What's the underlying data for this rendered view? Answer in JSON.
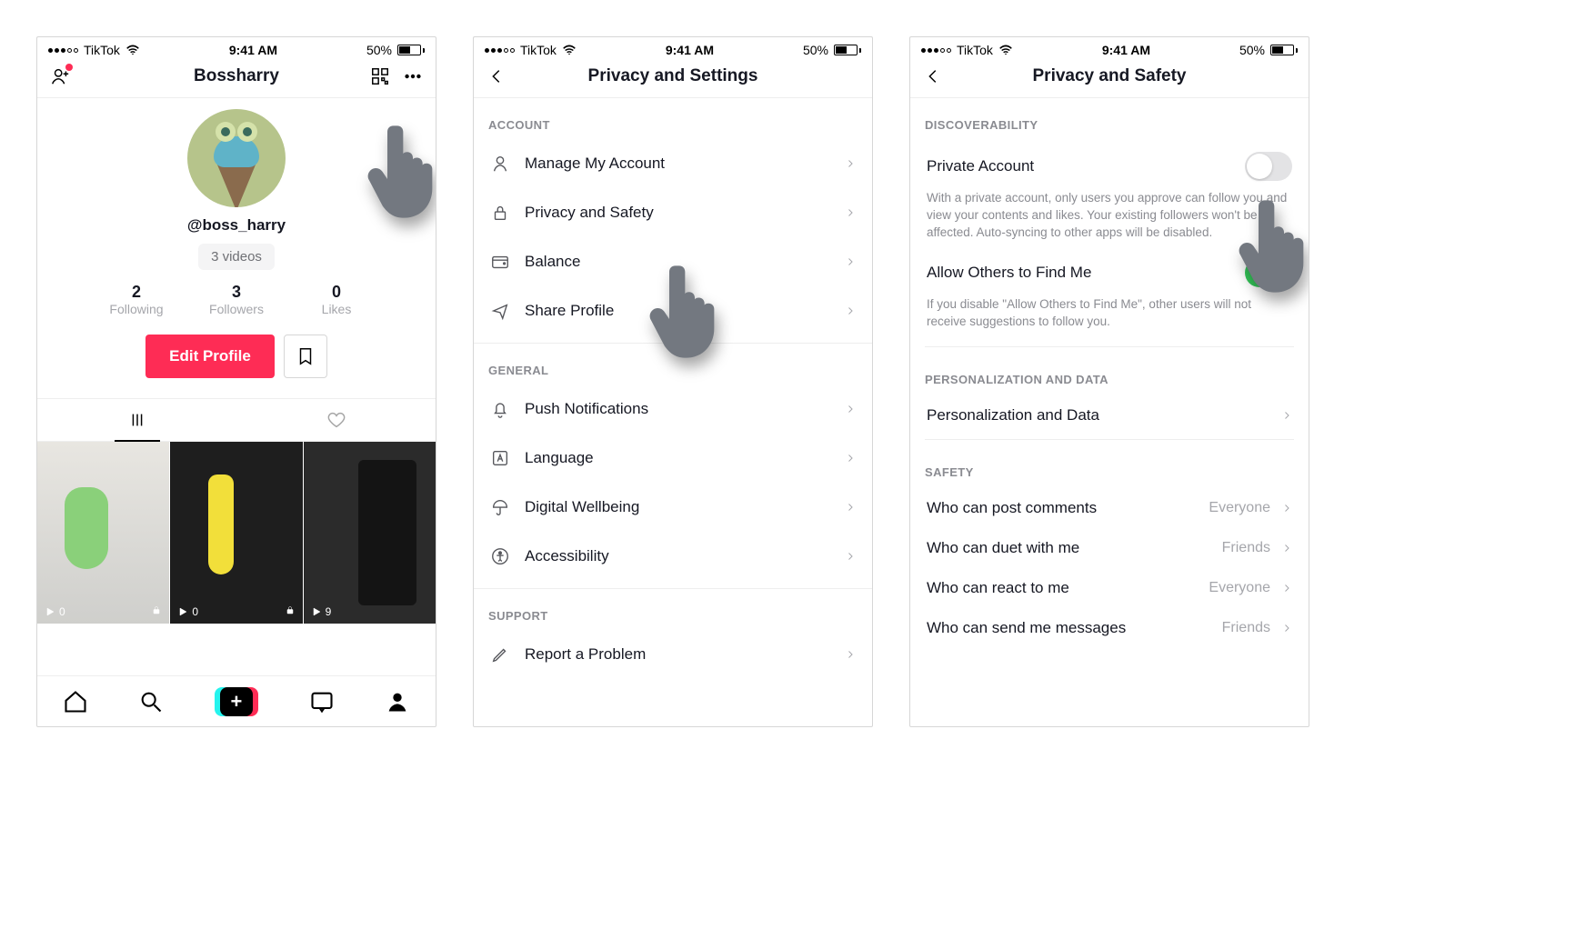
{
  "status": {
    "carrier": "TikTok",
    "time": "9:41 AM",
    "battery": "50%"
  },
  "screen1": {
    "title": "Bossharry",
    "username": "@boss_harry",
    "videos_chip": "3 videos",
    "stats": [
      {
        "num": "2",
        "label": "Following"
      },
      {
        "num": "3",
        "label": "Followers"
      },
      {
        "num": "0",
        "label": "Likes"
      }
    ],
    "edit_label": "Edit Profile",
    "thumbs": [
      {
        "plays": "0",
        "locked": true
      },
      {
        "plays": "0",
        "locked": true
      },
      {
        "plays": "9",
        "locked": false
      }
    ]
  },
  "screen2": {
    "title": "Privacy and Settings",
    "sections": {
      "account": {
        "header": "ACCOUNT",
        "items": [
          {
            "label": "Manage My Account"
          },
          {
            "label": "Privacy and Safety"
          },
          {
            "label": "Balance"
          },
          {
            "label": "Share Profile"
          }
        ]
      },
      "general": {
        "header": "GENERAL",
        "items": [
          {
            "label": "Push Notifications"
          },
          {
            "label": "Language"
          },
          {
            "label": "Digital Wellbeing"
          },
          {
            "label": "Accessibility"
          }
        ]
      },
      "support": {
        "header": "SUPPORT",
        "items": [
          {
            "label": "Report a Problem"
          }
        ]
      }
    }
  },
  "screen3": {
    "title": "Privacy and Safety",
    "discoverability_header": "DISCOVERABILITY",
    "private_account": {
      "label": "Private Account",
      "desc": "With a private account, only users you approve can follow you and view your contents and likes. Your existing followers won't be affected. Auto-syncing to other apps will be disabled.",
      "on": false
    },
    "allow_find": {
      "label": "Allow Others to Find Me",
      "desc": "If you disable \"Allow Others to Find Me\", other users will not receive suggestions to follow you.",
      "on": true
    },
    "personalization_header": "PERSONALIZATION AND DATA",
    "personalization_label": "Personalization and Data",
    "safety_header": "SAFETY",
    "safety_rows": [
      {
        "label": "Who can post comments",
        "value": "Everyone"
      },
      {
        "label": "Who can duet with me",
        "value": "Friends"
      },
      {
        "label": "Who can react to me",
        "value": "Everyone"
      },
      {
        "label": "Who can send me messages",
        "value": "Friends"
      }
    ]
  }
}
